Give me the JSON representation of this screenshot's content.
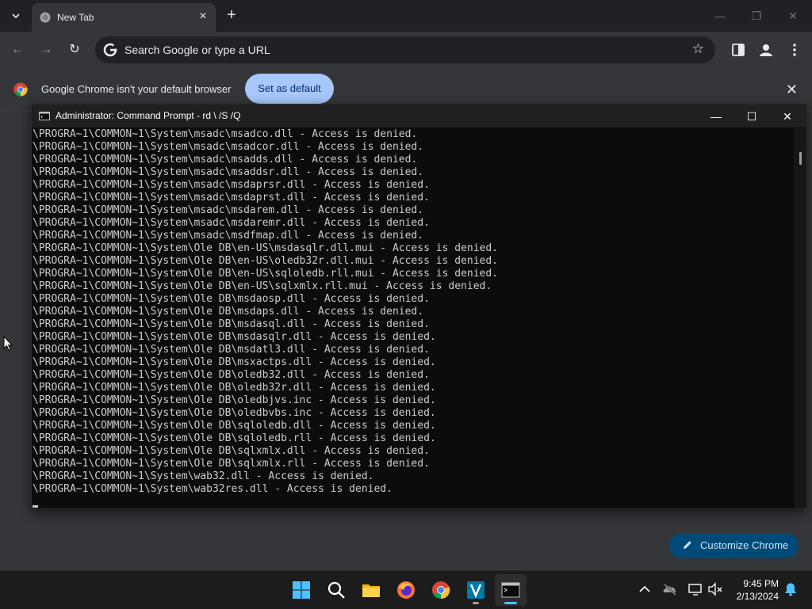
{
  "browser": {
    "tab_title": "New Tab",
    "omnibox_placeholder": "Search Google or type a URL",
    "infobar_message": "Google Chrome isn't your default browser",
    "set_default_label": "Set as default",
    "customize_label": "Customize Chrome",
    "accent_color": "#a8c7fa"
  },
  "cmd": {
    "title": "Administrator: Command Prompt - rd  \\ /S /Q",
    "lines": [
      "\\PROGRA~1\\COMMON~1\\System\\msadc\\msadco.dll - Access is denied.",
      "\\PROGRA~1\\COMMON~1\\System\\msadc\\msadcor.dll - Access is denied.",
      "\\PROGRA~1\\COMMON~1\\System\\msadc\\msadds.dll - Access is denied.",
      "\\PROGRA~1\\COMMON~1\\System\\msadc\\msaddsr.dll - Access is denied.",
      "\\PROGRA~1\\COMMON~1\\System\\msadc\\msdaprsr.dll - Access is denied.",
      "\\PROGRA~1\\COMMON~1\\System\\msadc\\msdaprst.dll - Access is denied.",
      "\\PROGRA~1\\COMMON~1\\System\\msadc\\msdarem.dll - Access is denied.",
      "\\PROGRA~1\\COMMON~1\\System\\msadc\\msdaremr.dll - Access is denied.",
      "\\PROGRA~1\\COMMON~1\\System\\msadc\\msdfmap.dll - Access is denied.",
      "\\PROGRA~1\\COMMON~1\\System\\Ole DB\\en-US\\msdasqlr.dll.mui - Access is denied.",
      "\\PROGRA~1\\COMMON~1\\System\\Ole DB\\en-US\\oledb32r.dll.mui - Access is denied.",
      "\\PROGRA~1\\COMMON~1\\System\\Ole DB\\en-US\\sqloledb.rll.mui - Access is denied.",
      "\\PROGRA~1\\COMMON~1\\System\\Ole DB\\en-US\\sqlxmlx.rll.mui - Access is denied.",
      "\\PROGRA~1\\COMMON~1\\System\\Ole DB\\msdaosp.dll - Access is denied.",
      "\\PROGRA~1\\COMMON~1\\System\\Ole DB\\msdaps.dll - Access is denied.",
      "\\PROGRA~1\\COMMON~1\\System\\Ole DB\\msdasql.dll - Access is denied.",
      "\\PROGRA~1\\COMMON~1\\System\\Ole DB\\msdasqlr.dll - Access is denied.",
      "\\PROGRA~1\\COMMON~1\\System\\Ole DB\\msdatl3.dll - Access is denied.",
      "\\PROGRA~1\\COMMON~1\\System\\Ole DB\\msxactps.dll - Access is denied.",
      "\\PROGRA~1\\COMMON~1\\System\\Ole DB\\oledb32.dll - Access is denied.",
      "\\PROGRA~1\\COMMON~1\\System\\Ole DB\\oledb32r.dll - Access is denied.",
      "\\PROGRA~1\\COMMON~1\\System\\Ole DB\\oledbjvs.inc - Access is denied.",
      "\\PROGRA~1\\COMMON~1\\System\\Ole DB\\oledbvbs.inc - Access is denied.",
      "\\PROGRA~1\\COMMON~1\\System\\Ole DB\\sqloledb.dll - Access is denied.",
      "\\PROGRA~1\\COMMON~1\\System\\Ole DB\\sqloledb.rll - Access is denied.",
      "\\PROGRA~1\\COMMON~1\\System\\Ole DB\\sqlxmlx.dll - Access is denied.",
      "\\PROGRA~1\\COMMON~1\\System\\Ole DB\\sqlxmlx.rll - Access is denied.",
      "\\PROGRA~1\\COMMON~1\\System\\wab32.dll - Access is denied.",
      "\\PROGRA~1\\COMMON~1\\System\\wab32res.dll - Access is denied."
    ]
  },
  "taskbar": {
    "apps": [
      {
        "name": "start",
        "icon": "windows-logo-icon",
        "active": false
      },
      {
        "name": "search",
        "icon": "search-icon",
        "active": false
      },
      {
        "name": "file-explorer",
        "icon": "folder-icon",
        "active": false
      },
      {
        "name": "firefox",
        "icon": "firefox-icon",
        "active": false
      },
      {
        "name": "chrome",
        "icon": "chrome-icon",
        "active": false
      },
      {
        "name": "app-v",
        "icon": "v-app-icon",
        "active": false
      },
      {
        "name": "command-prompt",
        "icon": "terminal-icon",
        "active": true
      }
    ],
    "time": "9:45 PM",
    "date": "2/13/2024"
  }
}
